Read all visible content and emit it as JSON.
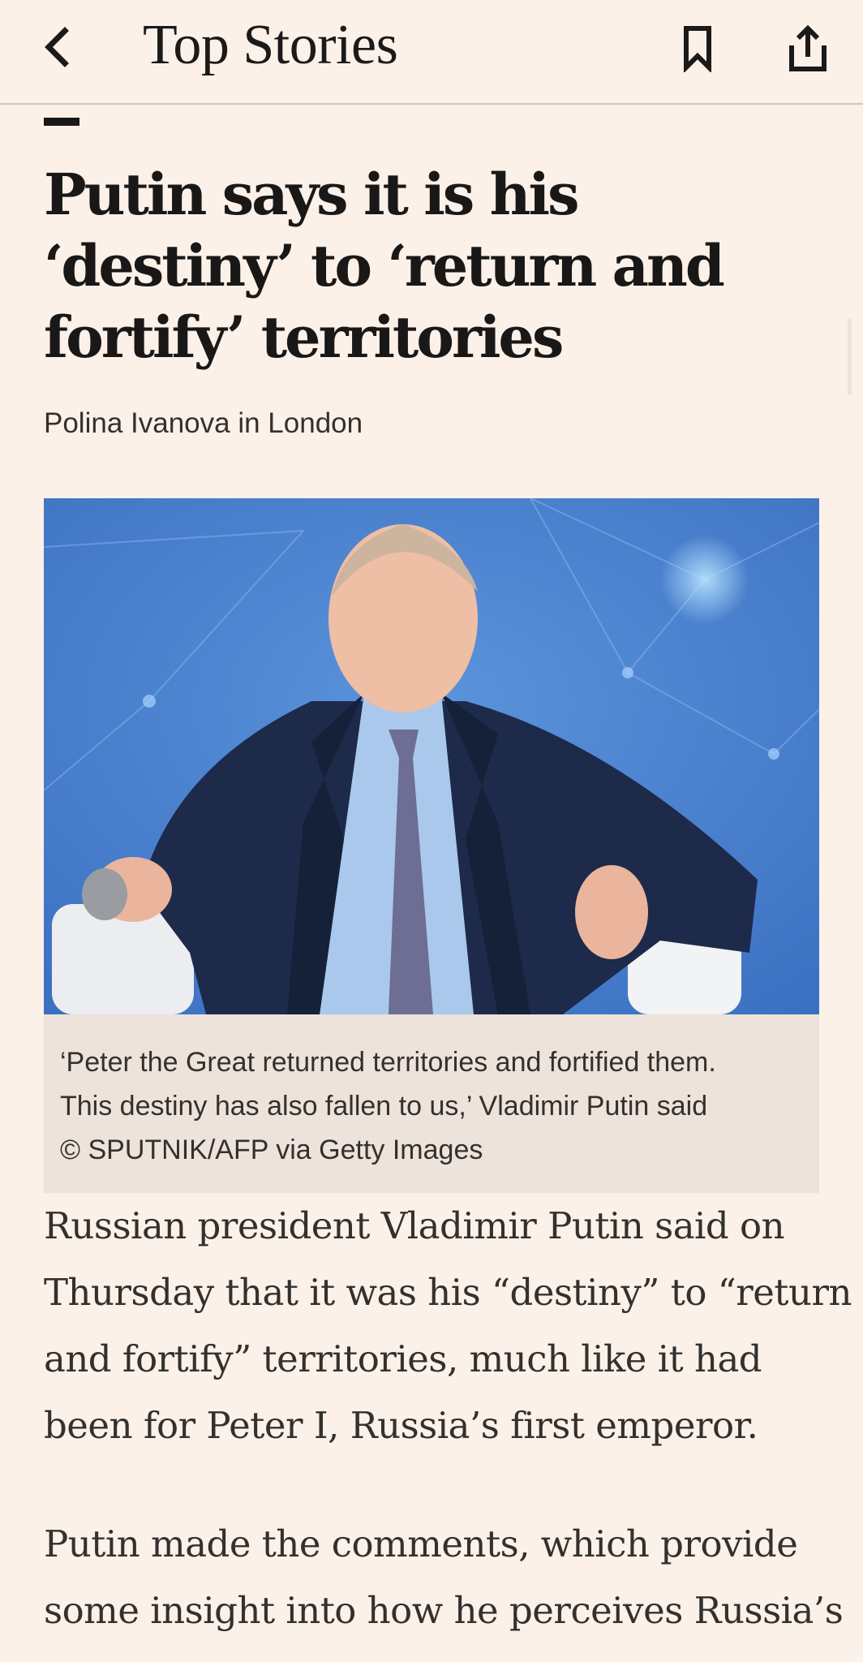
{
  "header": {
    "title": "Top Stories",
    "back_icon": "chevron-left-icon",
    "bookmark_icon": "bookmark-icon",
    "share_icon": "share-icon"
  },
  "article": {
    "headline": "Putin says it is his ‘destiny’ to ‘return and fortify’ territories",
    "byline": "Polina Ivanova in London",
    "image_caption_lines": [
      "‘Peter the Great returned territories and fortified them.",
      "This destiny has also fallen to us,’ Vladimir Putin said",
      "© SPUTNIK/AFP via Getty Images"
    ],
    "paragraph_1_lines": [
      "Russian president Vladimir Putin said on",
      "Thursday that it was his “destiny” to “return",
      "and fortify” territories, much like it had",
      "been for Peter I, Russia’s first emperor."
    ],
    "paragraph_2_lines": [
      "Putin made the comments, which provide",
      "some insight into how he perceives Russia’s"
    ]
  },
  "colors": {
    "page_background": "#fbf1e9",
    "caption_background": "#ede3db",
    "text_primary": "#1a1817",
    "text_secondary": "#33302e",
    "photo_background": "#3f78c8"
  }
}
